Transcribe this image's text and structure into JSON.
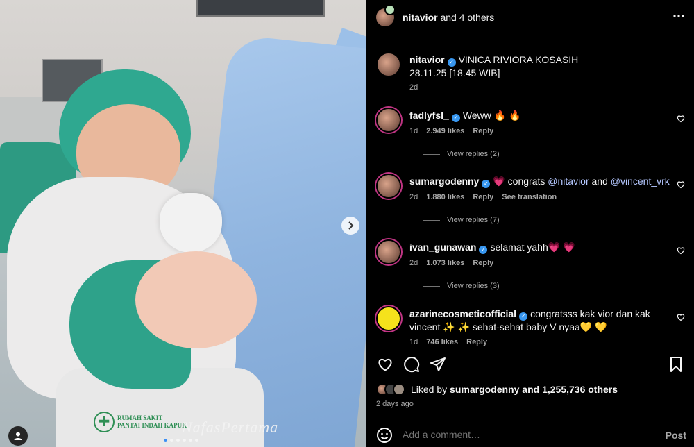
{
  "media": {
    "logo_text": "RUMAH SAKIT PANTAI INDAH KAPUK",
    "logo_line1": "RUMAH SAKIT",
    "logo_line2": "PANTAI INDAH KAPUK",
    "watermark": "NafasPertama",
    "next_icon": "chevron-right-icon",
    "dots_count": 6
  },
  "header": {
    "username": "nitavior",
    "coauthors": "and 4 others",
    "more_icon": "more-horizontal-icon"
  },
  "caption": {
    "username": "nitavior",
    "text": "VINICA RIVIORA KOSASIH",
    "line2": "28.11.25 [18.45 WIB]",
    "time": "2d"
  },
  "comments": [
    {
      "username": "fadlyfsl_",
      "text": "Weww 🔥 🔥",
      "time": "1d",
      "likes": "2.949 likes",
      "reply": "Reply",
      "translate": "",
      "view_replies": "View replies (2)"
    },
    {
      "username": "sumargodenny",
      "text_prefix": "💗 congrats ",
      "mention1": "@nitavior",
      "mid": " and ",
      "mention2": "@vincent_vrk",
      "time": "2d",
      "likes": "1.880 likes",
      "reply": "Reply",
      "translate": "See translation",
      "view_replies": "View replies (7)"
    },
    {
      "username": "ivan_gunawan",
      "text": "selamat yahh💗 💗",
      "time": "2d",
      "likes": "1.073 likes",
      "reply": "Reply",
      "translate": "",
      "view_replies": "View replies (3)"
    },
    {
      "username": "azarinecosmeticofficial",
      "text": "congratsss kak vior dan kak vincent ✨ ✨ sehat-sehat baby V nyaa💛 💛",
      "time": "1d",
      "likes": "746 likes",
      "reply": "Reply",
      "translate": "",
      "view_replies": ""
    }
  ],
  "actions": {
    "like_icon": "heart-icon",
    "comment_icon": "comment-icon",
    "share_icon": "share-icon",
    "save_icon": "bookmark-icon"
  },
  "likes": {
    "prefix": "Liked by",
    "user": "sumargodenny",
    "suffix": "and 1,255,736 others"
  },
  "posted": "2 days ago",
  "comment_box": {
    "placeholder": "Add a comment…",
    "post_label": "Post",
    "emoji_icon": "emoji-icon"
  },
  "colors": {
    "background": "#000000",
    "verified": "#3897f0",
    "mention": "#b4c7ff",
    "muted": "#a8a8a8"
  }
}
